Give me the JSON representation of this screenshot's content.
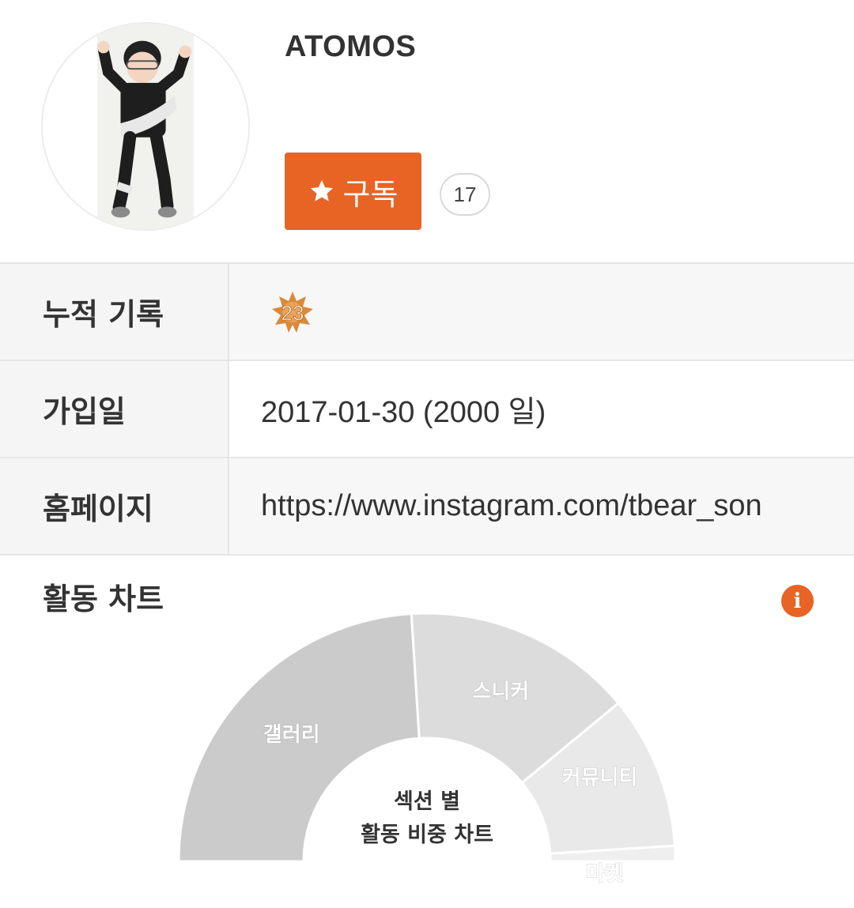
{
  "profile": {
    "username": "ATOMOS",
    "subscribe_label": "구독",
    "subscriber_count": "17"
  },
  "info": {
    "rows": [
      {
        "label": "누적 기록",
        "value": "",
        "badge_number": "23",
        "badge_color": "#d98a3a"
      },
      {
        "label": "가입일",
        "value": "2017-01-30 (2000 일)"
      },
      {
        "label": "홈페이지",
        "value": "https://www.instagram.com/tbear_son"
      }
    ]
  },
  "activity": {
    "title": "활동 차트",
    "center_label_line1": "섹션 별",
    "center_label_line2": "활동 비중 차트"
  },
  "colors": {
    "accent": "#e76424",
    "slice_gallery": "#cbcbcb",
    "slice_sneaker": "#dcdcdc",
    "slice_community": "#e9e9e9",
    "slice_market": "#efefef"
  },
  "chart_data": {
    "type": "pie",
    "categories": [
      "갤러리",
      "스니커",
      "커뮤니티",
      "마켓"
    ],
    "values": [
      48,
      30,
      20,
      2
    ],
    "title": "섹션 별 활동 비중 차트"
  }
}
